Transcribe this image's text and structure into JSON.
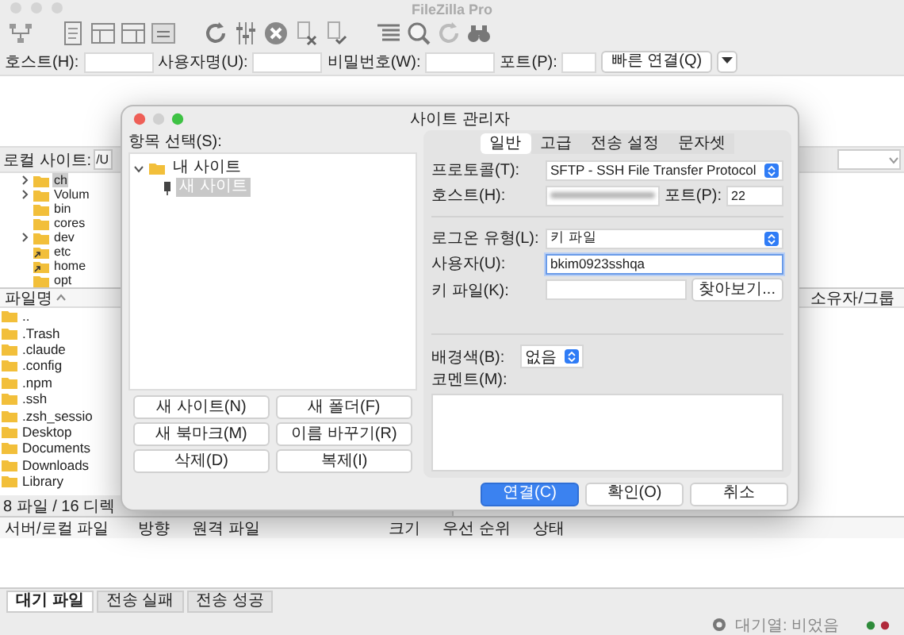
{
  "window": {
    "title": "FileZilla Pro"
  },
  "quickconnect": {
    "fields": [
      {
        "label": "호스트(H):"
      },
      {
        "label": "사용자명(U):"
      },
      {
        "label": "비밀번호(W):"
      },
      {
        "label": "포트(P):"
      }
    ],
    "button": "빠른 연결(Q)"
  },
  "local": {
    "site_label": "로컬 사이트:",
    "path": "/U",
    "tree": [
      {
        "label": "ch",
        "kind": "folder",
        "expandable": true,
        "selected": true
      },
      {
        "label": "Volum",
        "kind": "folder",
        "expandable": true,
        "selected": false
      },
      {
        "label": "bin",
        "kind": "folder",
        "expandable": false,
        "selected": false
      },
      {
        "label": "cores",
        "kind": "folder",
        "expandable": false,
        "selected": false
      },
      {
        "label": "dev",
        "kind": "folder",
        "expandable": true,
        "selected": false
      },
      {
        "label": "etc",
        "kind": "link",
        "expandable": false,
        "selected": false
      },
      {
        "label": "home",
        "kind": "link",
        "expandable": false,
        "selected": false
      },
      {
        "label": "opt",
        "kind": "folder",
        "expandable": false,
        "selected": false
      }
    ],
    "file_header": "파일명",
    "files": [
      {
        "label": ".."
      },
      {
        "label": ".Trash"
      },
      {
        "label": ".claude"
      },
      {
        "label": ".config"
      },
      {
        "label": ".npm"
      },
      {
        "label": ".ssh"
      },
      {
        "label": ".zsh_sessio"
      },
      {
        "label": "Desktop"
      },
      {
        "label": "Documents"
      },
      {
        "label": "Downloads"
      },
      {
        "label": "Library"
      }
    ],
    "status": "8 파일 / 16 디렉"
  },
  "remote": {
    "header": "소유자/그룹"
  },
  "queue": {
    "columns": [
      "서버/로컬 파일",
      "방향",
      "원격 파일",
      "크기",
      "우선 순위",
      "상태"
    ],
    "tabs": [
      {
        "label": "대기 파일",
        "selected": true
      },
      {
        "label": "전송 실패",
        "selected": false
      },
      {
        "label": "전송 성공",
        "selected": false
      }
    ]
  },
  "status_bar": {
    "queue": "대기열: 비었음"
  },
  "dialog": {
    "title": "사이트 관리자",
    "tree_label": "항목 선택(S):",
    "tree": [
      {
        "label": "내 사이트",
        "expanded": true,
        "selected": false,
        "children": [
          {
            "label": "새 사이트",
            "selected": true
          }
        ]
      }
    ],
    "buttons": [
      "새 사이트(N)",
      "새 폴더(F)",
      "새 북마크(M)",
      "이름 바꾸기(R)",
      "삭제(D)",
      "복제(I)"
    ],
    "tabs": [
      {
        "label": "일반",
        "selected": true
      },
      {
        "label": "고급",
        "selected": false
      },
      {
        "label": "전송 설정",
        "selected": false
      },
      {
        "label": "문자셋",
        "selected": false
      }
    ],
    "protocol": {
      "label": "프로토콜(T):",
      "value": "SFTP - SSH File Transfer Protocol"
    },
    "host": {
      "label": "호스트(H):"
    },
    "port": {
      "label": "포트(P):",
      "value": "22"
    },
    "logon_type": {
      "label": "로그온 유형(L):",
      "value": "키 파일"
    },
    "user": {
      "label": "사용자(U):",
      "value": "bkim0923sshqa",
      "focused": true
    },
    "key_file": {
      "label": "키 파일(K):",
      "browse": "찾아보기..."
    },
    "background": {
      "label": "배경색(B):",
      "value": "없음"
    },
    "comment": {
      "label": "코멘트(M):"
    },
    "actions": [
      {
        "label": "연결(C)",
        "primary": true
      },
      {
        "label": "확인(O)",
        "primary": false
      },
      {
        "label": "취소",
        "primary": false
      }
    ]
  }
}
